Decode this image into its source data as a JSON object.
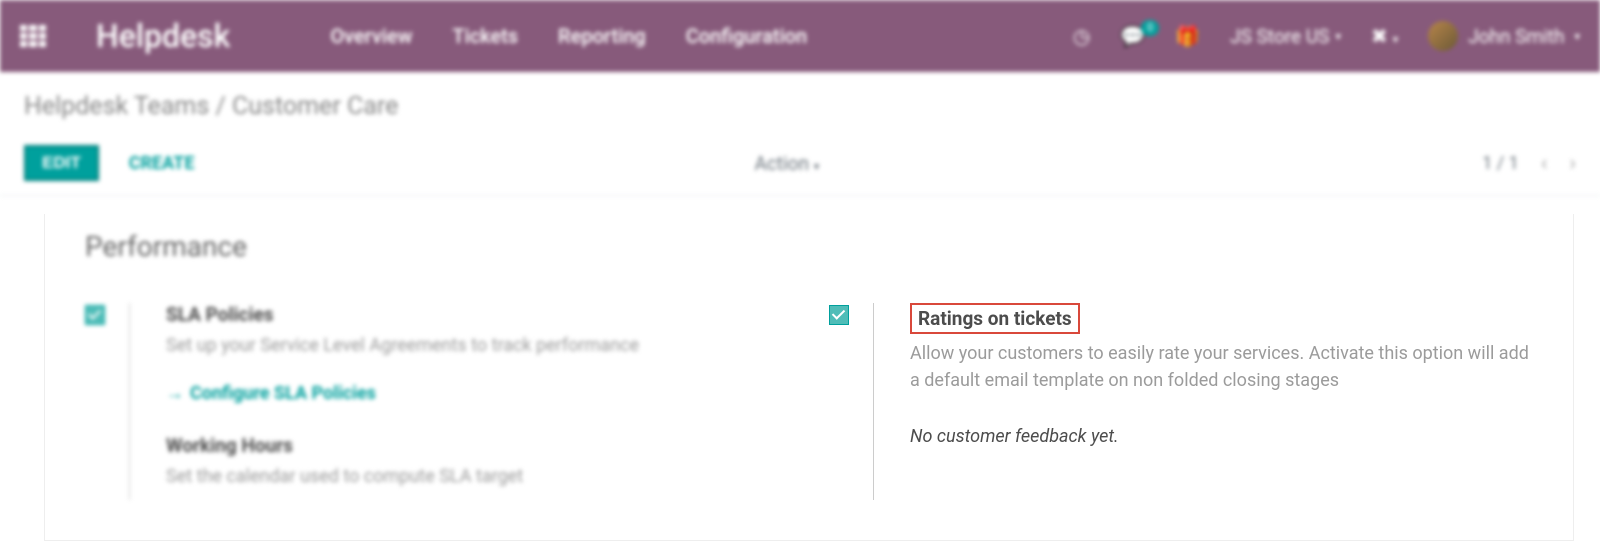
{
  "navbar": {
    "app_title": "Helpdesk",
    "links": [
      "Overview",
      "Tickets",
      "Reporting",
      "Configuration"
    ],
    "messages_badge": "0",
    "company": "JS Store US",
    "user": "John Smith"
  },
  "breadcrumb": {
    "parent": "Helpdesk Teams",
    "separator": "/",
    "current": "Customer Care"
  },
  "controls": {
    "edit": "EDIT",
    "create": "CREATE",
    "action": "Action",
    "pager": "1 / 1"
  },
  "section": {
    "title": "Performance",
    "left": {
      "sla_title": "SLA Policies",
      "sla_desc": "Set up your Service Level Agreements to track performance",
      "sla_link": "Configure SLA Policies",
      "wh_title": "Working Hours",
      "wh_desc": "Set the calendar used to compute SLA target"
    },
    "right": {
      "ratings_title": "Ratings on tickets",
      "ratings_desc": "Allow your customers to easily rate your services. Activate this option will add a default email template on non folded closing stages",
      "feedback": "No customer feedback yet."
    }
  }
}
